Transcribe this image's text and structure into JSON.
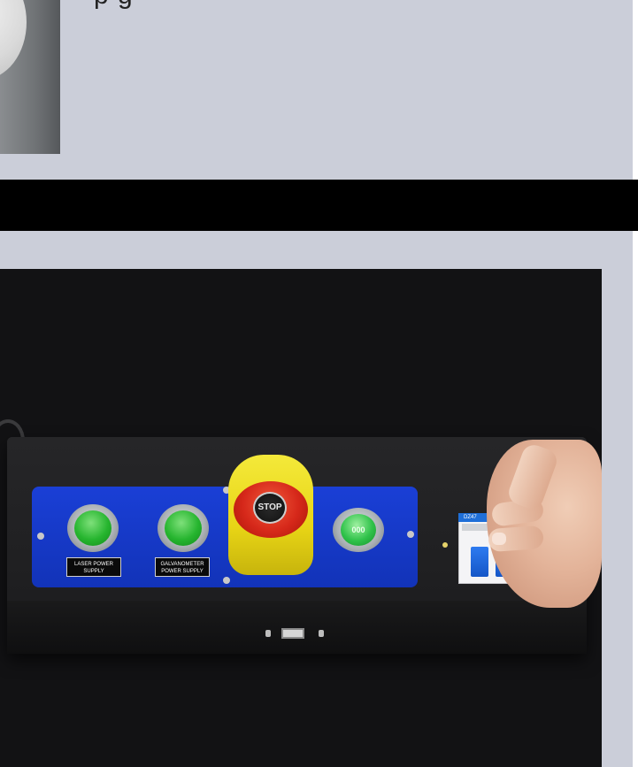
{
  "top": {
    "text_fragment": "p                                            g"
  },
  "panel": {
    "buttons": [
      {
        "label": "LASER POWER SUPPLY"
      },
      {
        "label": "GALVANOMETER POWER SUPPLY"
      }
    ],
    "stop_label": "STOP",
    "indicator_text": "000",
    "breaker_tag": "DZ47"
  },
  "colors": {
    "plate_blue": "#1a3fd6",
    "button_green": "#26b52f",
    "stop_red": "#d6281a",
    "guard_yellow": "#e8d516"
  }
}
